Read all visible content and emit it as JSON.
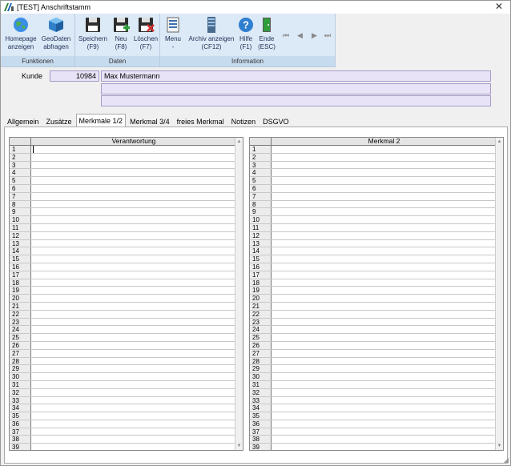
{
  "window": {
    "title": "[TEST] Anschriftstamm",
    "close_glyph": "✕"
  },
  "ribbon": {
    "groups": [
      {
        "caption": "Funktionen",
        "buttons": [
          {
            "line1": "Homepage",
            "line2": "anzeigen",
            "icon": "globe-icon"
          },
          {
            "line1": "GeoDaten",
            "line2": "abfragen",
            "icon": "cube-icon"
          }
        ]
      },
      {
        "caption": "Daten",
        "buttons": [
          {
            "line1": "Speichern",
            "line2": "(F9)",
            "icon": "floppy-icon"
          },
          {
            "line1": "Neu",
            "line2": "(F8)",
            "icon": "floppy-add-icon"
          },
          {
            "line1": "Löschen",
            "line2": "(F7)",
            "icon": "floppy-delete-icon"
          }
        ]
      },
      {
        "caption": "Information",
        "buttons": [
          {
            "line1": "Menu",
            "line2": "-",
            "icon": "menu-list-icon"
          },
          {
            "line1": "Archiv anzeigen",
            "line2": "(CF12)",
            "icon": "server-icon"
          },
          {
            "line1": "Hilfe",
            "line2": "(F1)",
            "icon": "help-icon"
          },
          {
            "line1": "Ende",
            "line2": "(ESC)",
            "icon": "exit-door-icon"
          }
        ]
      }
    ],
    "nav": [
      "⏮",
      "◀",
      "▶",
      "⏭"
    ]
  },
  "customer": {
    "label": "Kunde",
    "number": "10984",
    "name": "Max Mustermann",
    "line2": "",
    "line3": ""
  },
  "tabs": [
    "Allgemein",
    "Zusätze",
    "Merkmale 1/2",
    "Merkmal 3/4",
    "freies Merkmal",
    "Notizen",
    "DSGVO"
  ],
  "active_tab": "Merkmale 1/2",
  "grids": [
    {
      "header": "Verantwortung"
    },
    {
      "header": "Merkmal 2"
    }
  ],
  "row_numbers": [
    "1",
    "2",
    "3",
    "4",
    "5",
    "6",
    "7",
    "8",
    "9",
    "10",
    "11",
    "12",
    "13",
    "14",
    "15",
    "16",
    "17",
    "18",
    "19",
    "20",
    "21",
    "22",
    "23",
    "24",
    "25",
    "26",
    "27",
    "28",
    "29",
    "30",
    "31",
    "32",
    "33",
    "34",
    "35",
    "36",
    "37",
    "38",
    "39"
  ],
  "colors": {
    "ribbon_bg": "#dce9f6",
    "field_bg": "#e8e3f6",
    "field_border": "#a79cc7"
  }
}
